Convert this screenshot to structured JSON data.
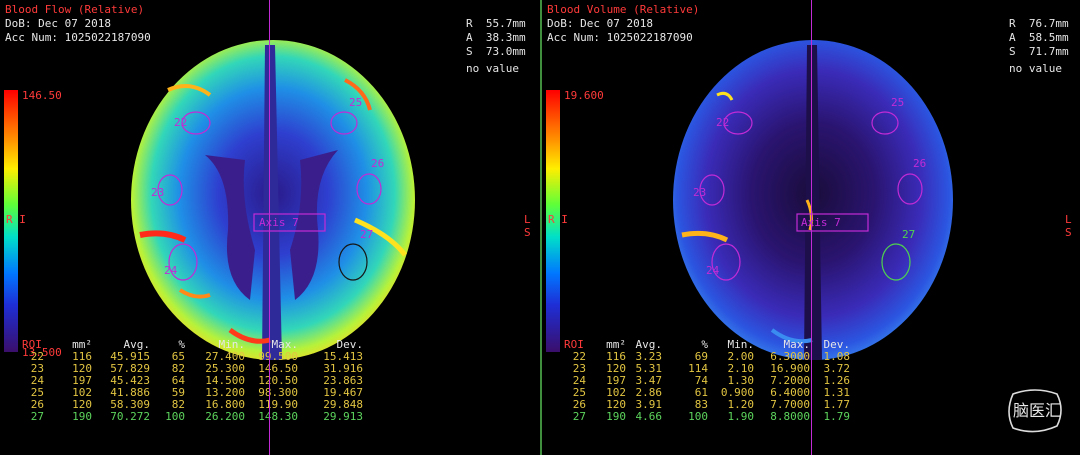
{
  "left": {
    "title": "Blood Flow (Relative)",
    "dob": "DoB: Dec 07 2018",
    "acc": "Acc Num: 1025022187090",
    "coords": [
      "R  55.7mm",
      "A  38.3mm",
      "S  73.0mm",
      "no value"
    ],
    "scale_max": "146.50",
    "scale_min": "13.500",
    "side_left": "R\nI",
    "side_right": "L\nS",
    "axis_label": "Axis 7",
    "roi_labels": [
      "22",
      "23",
      "24",
      "25",
      "26",
      "27"
    ],
    "table": {
      "headers": [
        "ROI",
        "mm²",
        "Avg.",
        "%",
        "Min.",
        "Max.",
        "Dev."
      ],
      "rows": [
        [
          "22",
          "116",
          "45.915",
          "65",
          "27.400",
          "99.500",
          "15.413"
        ],
        [
          "23",
          "120",
          "57.829",
          "82",
          "25.300",
          "146.50",
          "31.916"
        ],
        [
          "24",
          "197",
          "45.423",
          "64",
          "14.500",
          "120.50",
          "23.863"
        ],
        [
          "25",
          "102",
          "41.886",
          "59",
          "13.200",
          "98.300",
          "19.467"
        ],
        [
          "26",
          "120",
          "58.309",
          "82",
          "16.800",
          "119.90",
          "29.848"
        ],
        [
          "27",
          "190",
          "70.272",
          "100",
          "26.200",
          "148.30",
          "29.913"
        ]
      ]
    }
  },
  "right": {
    "title": "Blood Volume (Relative)",
    "dob": "DoB: Dec 07 2018",
    "acc": "Acc Num: 1025022187090",
    "coords": [
      "R  76.7mm",
      "A  58.5mm",
      "S  71.7mm",
      "no value"
    ],
    "scale_max": "19.600",
    "side_left": "R\nI",
    "side_right": "L\nS",
    "axis_label": "Axis 7",
    "roi_labels": [
      "22",
      "23",
      "24",
      "25",
      "26",
      "27"
    ],
    "table": {
      "headers": [
        "ROI",
        "mm²",
        "Avg.",
        "%",
        "Min.",
        "Max.",
        "Dev."
      ],
      "rows": [
        [
          "22",
          "116",
          "3.23",
          "69",
          "2.00",
          "6.3000",
          "1.08"
        ],
        [
          "23",
          "120",
          "5.31",
          "114",
          "2.10",
          "16.900",
          "3.72"
        ],
        [
          "24",
          "197",
          "3.47",
          "74",
          "1.30",
          "7.2000",
          "1.26"
        ],
        [
          "25",
          "102",
          "2.86",
          "61",
          "0.900",
          "6.4000",
          "1.31"
        ],
        [
          "26",
          "120",
          "3.91",
          "83",
          "1.20",
          "7.7000",
          "1.77"
        ],
        [
          "27",
          "190",
          "4.66",
          "100",
          "1.90",
          "8.8000",
          "1.79"
        ]
      ]
    }
  },
  "logo": {
    "text": "脑医汇"
  },
  "colors": {
    "title": "#ff3a3a",
    "roi_magenta": "#c22bd6",
    "roi_green": "#4fd24f",
    "table_text": "#e2c542"
  }
}
